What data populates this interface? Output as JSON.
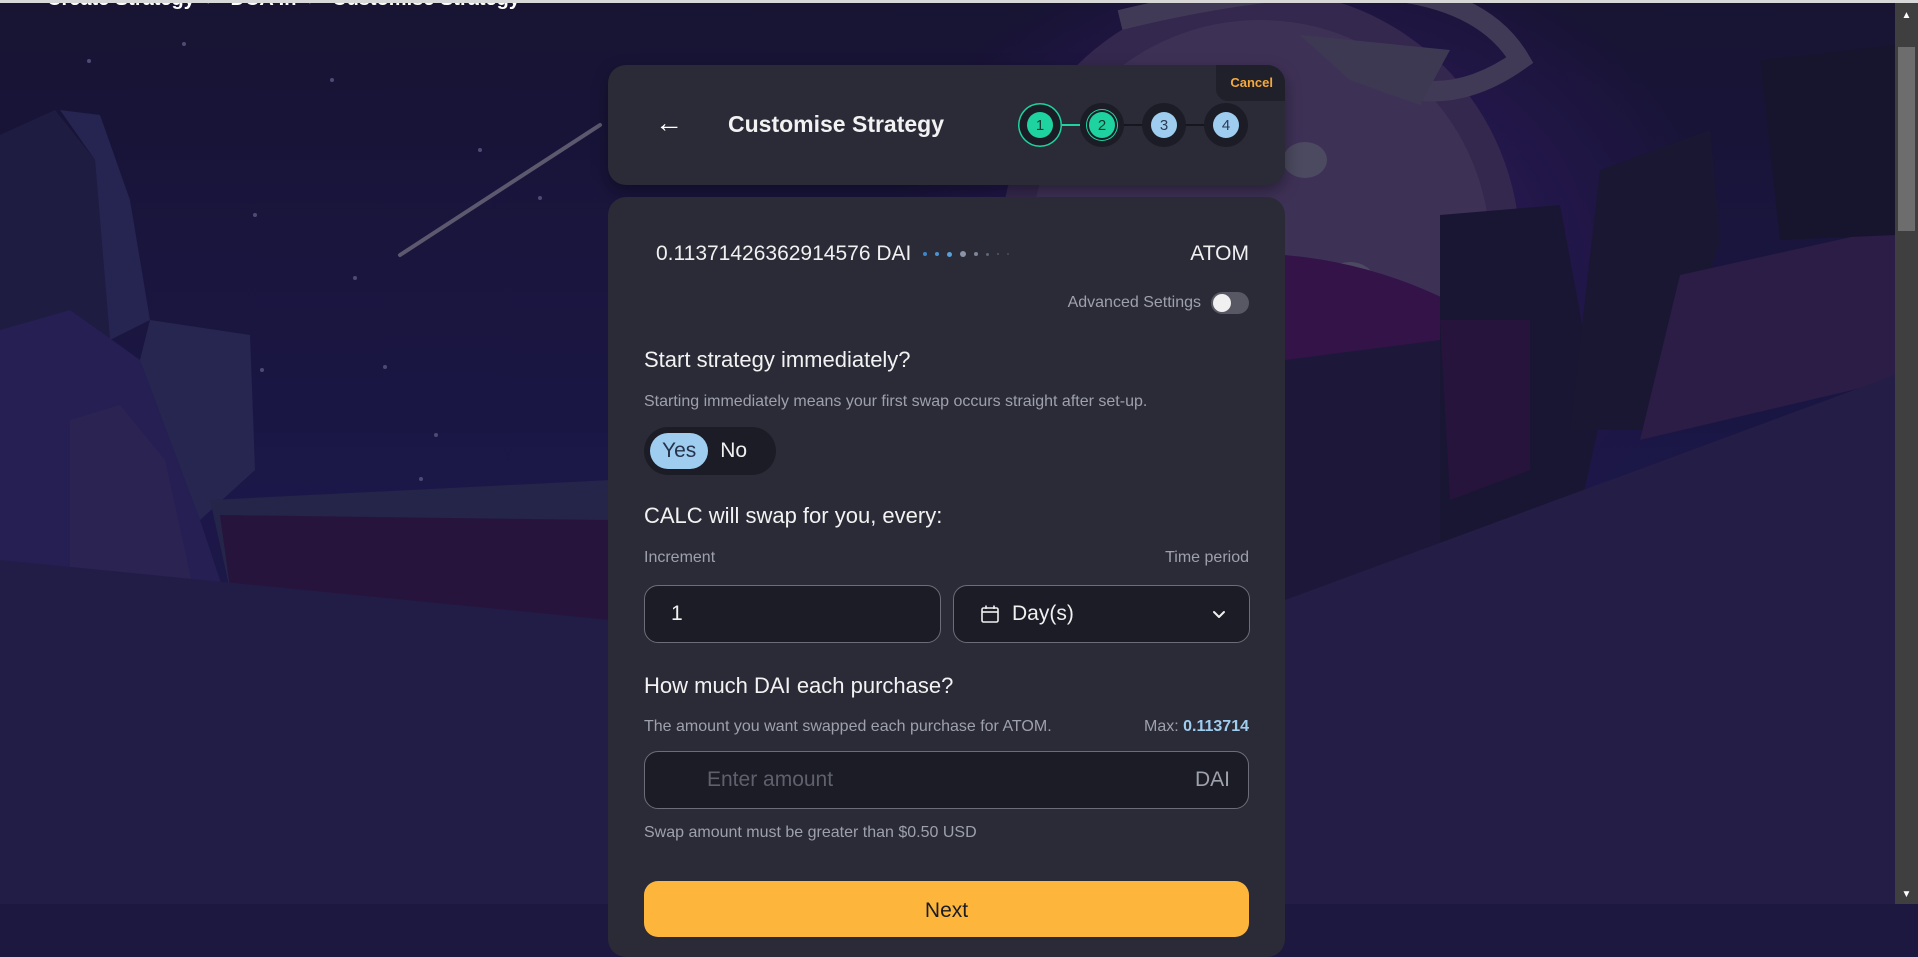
{
  "breadcrumb": {
    "items": [
      "Create Strategy",
      "DCA In",
      "Customise Strategy"
    ],
    "separator": ">"
  },
  "header": {
    "back_icon": "←",
    "title": "Customise Strategy",
    "cancel_label": "Cancel",
    "steps": [
      {
        "label": "1",
        "state": "complete"
      },
      {
        "label": "2",
        "state": "current"
      },
      {
        "label": "3",
        "state": "pending"
      },
      {
        "label": "4",
        "state": "pending"
      }
    ]
  },
  "summary": {
    "initial_amount": "0.11371426362914576 DAI",
    "target_denom": "ATOM"
  },
  "advanced_settings": {
    "label": "Advanced Settings",
    "enabled": false
  },
  "start_immediately": {
    "title": "Start strategy immediately?",
    "help": "Starting immediately means your first swap occurs straight after set-up.",
    "options": [
      "Yes",
      "No"
    ],
    "selected": "Yes"
  },
  "interval": {
    "title": "CALC will swap for you, every:",
    "increment_label": "Increment",
    "increment_value": "1",
    "time_period_label": "Time period",
    "time_period_value": "Day(s)"
  },
  "swap_amount": {
    "title": "How much DAI each purchase?",
    "help": "The amount you want swapped each purchase for ATOM.",
    "max_label": "Max:",
    "max_value": "0.113714",
    "placeholder": "Enter amount",
    "value": "",
    "suffix": "DAI",
    "validation": "Swap amount must be greater than $0.50 USD"
  },
  "next_label": "Next",
  "colors": {
    "accent_green": "#1fd3a0",
    "accent_blue": "#9fcdf0",
    "accent_orange": "#f5a93b",
    "button_yellow": "#fdb63b",
    "card_bg": "#2a2b37"
  }
}
